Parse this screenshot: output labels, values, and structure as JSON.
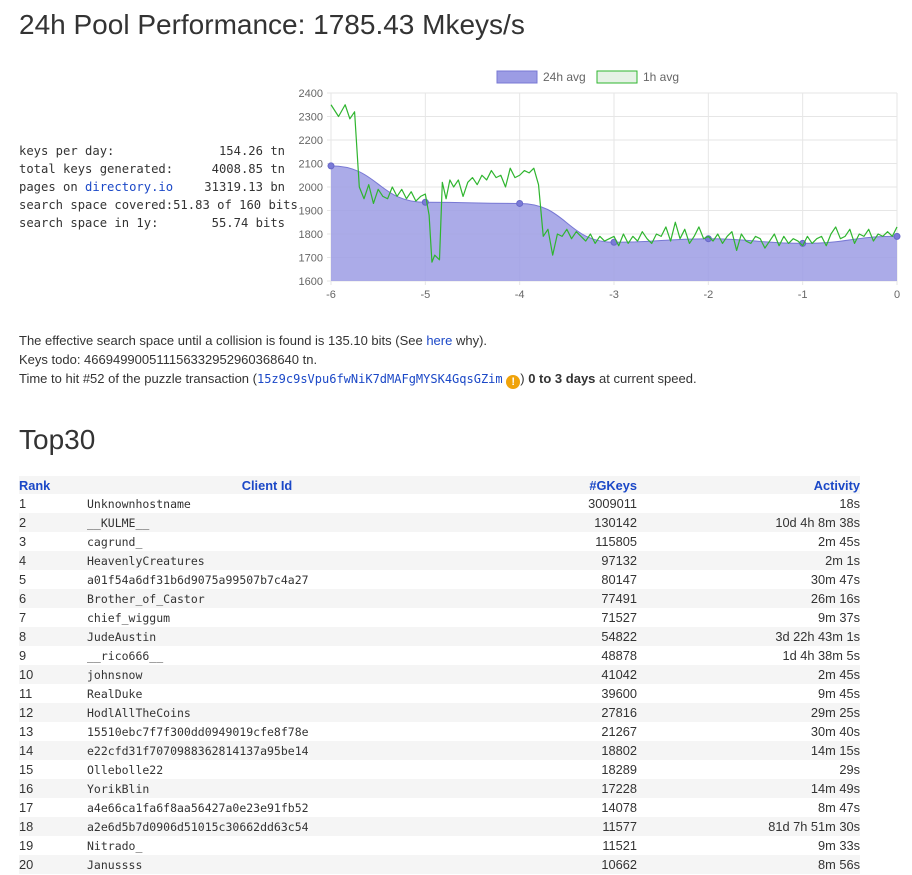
{
  "header": {
    "title": "24h Pool Performance: 1785.43 Mkeys/s"
  },
  "stats": [
    {
      "label": "keys per day:",
      "value": "154.26 tn"
    },
    {
      "label": "total keys generated:",
      "value": "4008.85 tn"
    },
    {
      "label_prefix": "pages on ",
      "label_link": "directory.io",
      "value": "31319.13 bn"
    },
    {
      "label": "search space covered:",
      "value": "51.83 of 160 bits"
    },
    {
      "label": "search space in 1y:",
      "value": "55.74 bits"
    }
  ],
  "info": {
    "line1_prefix": "The effective search space until a collision is found is 135.10 bits (See ",
    "line1_link": "here",
    "line1_suffix": " why).",
    "line2": "Keys todo: 466949900511156332952960368640 tn.",
    "line3_prefix": "Time to hit #52 of the puzzle transaction (",
    "line3_address": "15z9c9sVpu6fwNiK7dMAFgMYSK4GqsGZim",
    "line3_icon": "info-warning-icon",
    "line3_close": ") ",
    "line3_bold": "0 to 3 days",
    "line3_suffix": " at current speed."
  },
  "top": {
    "title": "Top30",
    "headers": {
      "rank": "Rank",
      "client": "Client Id",
      "gkeys": "#GKeys",
      "activity": "Activity"
    },
    "rows": [
      {
        "rank": "1",
        "client": "Unknownhostname",
        "gkeys": "3009011",
        "activity": "18s"
      },
      {
        "rank": "2",
        "client": "__KULME__",
        "gkeys": "130142",
        "activity": "10d 4h 8m 38s"
      },
      {
        "rank": "3",
        "client": "cagrund_",
        "gkeys": "115805",
        "activity": "2m 45s"
      },
      {
        "rank": "4",
        "client": "HeavenlyCreatures",
        "gkeys": "97132",
        "activity": "2m 1s"
      },
      {
        "rank": "5",
        "client": "a01f54a6df31b6d9075a99507b7c4a27",
        "gkeys": "80147",
        "activity": "30m 47s"
      },
      {
        "rank": "6",
        "client": "Brother_of_Castor",
        "gkeys": "77491",
        "activity": "26m 16s"
      },
      {
        "rank": "7",
        "client": "chief_wiggum",
        "gkeys": "71527",
        "activity": "9m 37s"
      },
      {
        "rank": "8",
        "client": "JudeAustin",
        "gkeys": "54822",
        "activity": "3d 22h 43m 1s"
      },
      {
        "rank": "9",
        "client": "__rico666__",
        "gkeys": "48878",
        "activity": "1d 4h 38m 5s"
      },
      {
        "rank": "10",
        "client": "johnsnow",
        "gkeys": "41042",
        "activity": "2m 45s"
      },
      {
        "rank": "11",
        "client": "RealDuke",
        "gkeys": "39600",
        "activity": "9m 45s"
      },
      {
        "rank": "12",
        "client": "HodlAllTheCoins",
        "gkeys": "27816",
        "activity": "29m 25s"
      },
      {
        "rank": "13",
        "client": "15510ebc7f7f300dd0949019cfe8f78e",
        "gkeys": "21267",
        "activity": "30m 40s"
      },
      {
        "rank": "14",
        "client": "e22cfd31f7070988362814137a95be14",
        "gkeys": "18802",
        "activity": "14m 15s"
      },
      {
        "rank": "15",
        "client": "Ollebolle22",
        "gkeys": "18289",
        "activity": "29s"
      },
      {
        "rank": "16",
        "client": "YorikBlin",
        "gkeys": "17228",
        "activity": "14m 49s"
      },
      {
        "rank": "17",
        "client": "a4e66ca1fa6f8aa56427a0e23e91fb52",
        "gkeys": "14078",
        "activity": "8m 47s"
      },
      {
        "rank": "18",
        "client": "a2e6d5b7d0906d51015c30662dd63c54",
        "gkeys": "11577",
        "activity": "81d 7h 51m 30s"
      },
      {
        "rank": "19",
        "client": "Nitrado_",
        "gkeys": "11521",
        "activity": "9m 33s"
      },
      {
        "rank": "20",
        "client": "Janussss",
        "gkeys": "10662",
        "activity": "8m 56s"
      }
    ]
  },
  "chart_data": {
    "type": "line",
    "legend_position": "top",
    "grid": true,
    "xlim": [
      -6,
      0
    ],
    "ylim": [
      1600,
      2400
    ],
    "x_ticks": [
      -6,
      -5,
      -4,
      -3,
      -2,
      -1,
      0
    ],
    "y_ticks": [
      1600,
      1700,
      1800,
      1900,
      2000,
      2100,
      2200,
      2300,
      2400
    ],
    "series": [
      {
        "name": "24h avg",
        "kind": "area",
        "fill": "#9c9ce4",
        "stroke": "#7878d4",
        "x": [
          -6,
          -5,
          -4,
          -3,
          -2,
          -1,
          0
        ],
        "y": [
          2090,
          1935,
          1930,
          1765,
          1780,
          1760,
          1790
        ]
      },
      {
        "name": "1h avg",
        "kind": "line",
        "fill": "#e6f2e6",
        "stroke": "#2fb52f",
        "x": [
          -6,
          -5.92,
          -5.85,
          -5.8,
          -5.75,
          -5.7,
          -5.65,
          -5.6,
          -5.55,
          -5.5,
          -5.45,
          -5.4,
          -5.35,
          -5.3,
          -5.25,
          -5.2,
          -5.15,
          -5.1,
          -5.05,
          -5.0,
          -4.96,
          -4.93,
          -4.9,
          -4.85,
          -4.82,
          -4.78,
          -4.74,
          -4.7,
          -4.65,
          -4.6,
          -4.55,
          -4.5,
          -4.45,
          -4.4,
          -4.35,
          -4.3,
          -4.25,
          -4.2,
          -4.15,
          -4.1,
          -4.05,
          -4.0,
          -3.95,
          -3.9,
          -3.85,
          -3.8,
          -3.75,
          -3.7,
          -3.65,
          -3.6,
          -3.55,
          -3.5,
          -3.45,
          -3.4,
          -3.35,
          -3.3,
          -3.25,
          -3.2,
          -3.15,
          -3.1,
          -3.05,
          -3.0,
          -2.95,
          -2.9,
          -2.85,
          -2.8,
          -2.75,
          -2.7,
          -2.65,
          -2.6,
          -2.55,
          -2.5,
          -2.45,
          -2.4,
          -2.35,
          -2.3,
          -2.25,
          -2.2,
          -2.15,
          -2.1,
          -2.05,
          -2.0,
          -1.95,
          -1.9,
          -1.85,
          -1.8,
          -1.75,
          -1.7,
          -1.65,
          -1.6,
          -1.55,
          -1.5,
          -1.45,
          -1.4,
          -1.35,
          -1.3,
          -1.25,
          -1.2,
          -1.15,
          -1.1,
          -1.05,
          -1.0,
          -0.95,
          -0.9,
          -0.85,
          -0.8,
          -0.75,
          -0.7,
          -0.65,
          -0.6,
          -0.55,
          -0.5,
          -0.45,
          -0.4,
          -0.35,
          -0.3,
          -0.25,
          -0.2,
          -0.15,
          -0.1,
          -0.05,
          0
        ],
        "y": [
          2350,
          2300,
          2350,
          2290,
          2320,
          2000,
          1950,
          2010,
          1930,
          1990,
          1960,
          1950,
          2000,
          1960,
          1990,
          1950,
          1980,
          1940,
          1960,
          1970,
          1880,
          1680,
          1710,
          1690,
          2020,
          1950,
          2030,
          2000,
          2030,
          1960,
          2020,
          2040,
          2010,
          2050,
          2030,
          2070,
          2040,
          2050,
          2000,
          2080,
          2040,
          2050,
          2070,
          2060,
          2080,
          2010,
          1790,
          1820,
          1710,
          1800,
          1790,
          1820,
          1780,
          1810,
          1790,
          1770,
          1800,
          1760,
          1790,
          1770,
          1780,
          1790,
          1750,
          1800,
          1760,
          1790,
          1770,
          1810,
          1780,
          1760,
          1800,
          1790,
          1830,
          1770,
          1850,
          1780,
          1820,
          1760,
          1790,
          1830,
          1780,
          1790,
          1770,
          1800,
          1760,
          1790,
          1810,
          1730,
          1800,
          1770,
          1760,
          1790,
          1780,
          1740,
          1770,
          1800,
          1750,
          1790,
          1760,
          1780,
          1770,
          1750,
          1790,
          1760,
          1780,
          1790,
          1750,
          1800,
          1830,
          1780,
          1790,
          1820,
          1760,
          1800,
          1790,
          1820,
          1770,
          1800,
          1790,
          1810,
          1790,
          1830
        ]
      }
    ],
    "markers_24h": true
  }
}
